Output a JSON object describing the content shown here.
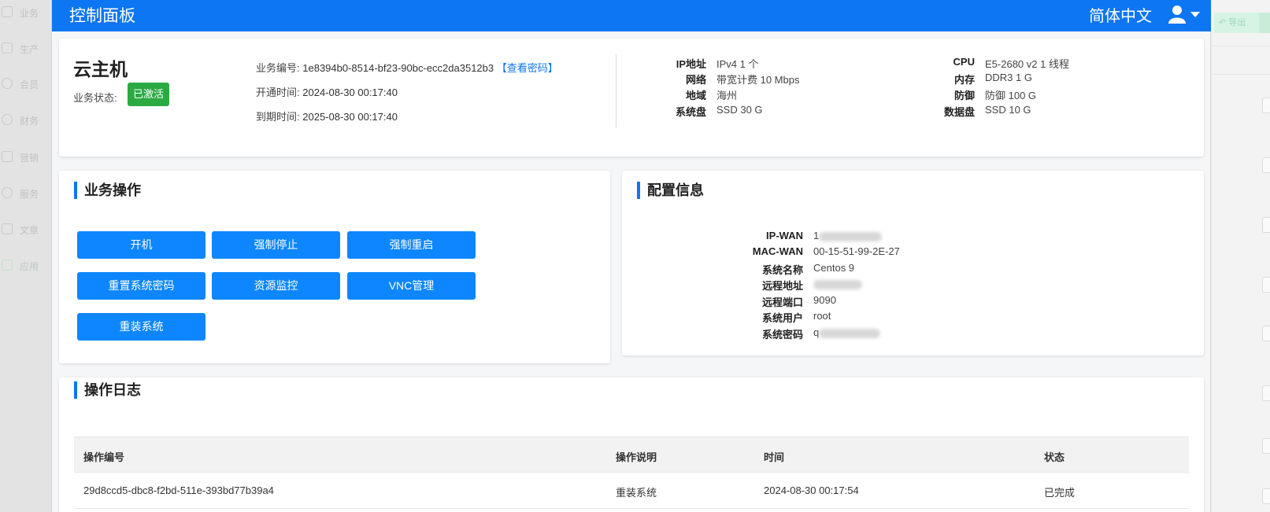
{
  "sidebar": {
    "items": [
      {
        "label": "业务",
        "icon": "document-icon"
      },
      {
        "label": "生产",
        "icon": "store-icon"
      },
      {
        "label": "会员",
        "icon": "user-icon"
      },
      {
        "label": "财务",
        "icon": "yen-icon"
      },
      {
        "label": "营销",
        "icon": "chart-icon"
      },
      {
        "label": "服务",
        "icon": "headset-icon"
      },
      {
        "label": "文章",
        "icon": "article-icon"
      },
      {
        "label": "应用",
        "icon": "cube-icon"
      }
    ]
  },
  "header": {
    "title": "控制面板",
    "language": "简体中文",
    "user_icon": "user-icon"
  },
  "summary": {
    "product_name": "云主机",
    "status_label": "业务状态:",
    "status_value": "已激活",
    "business_id_label": "业务编号:",
    "business_id": "1e8394b0-8514-bf23-90bc-ecc2da3512b3",
    "view_password": "【查看密码】",
    "open_time_label": "开通时间:",
    "open_time": "2024-08-30 00:17:40",
    "expire_time_label": "到期时间:",
    "expire_time": "2025-08-30 00:17:40",
    "specs_left": [
      {
        "key": "IP地址",
        "value": "IPv4 1 个"
      },
      {
        "key": "网络",
        "value": "带宽计费 10 Mbps"
      },
      {
        "key": "地域",
        "value": "海州"
      },
      {
        "key": "系统盘",
        "value": "SSD 30 G"
      }
    ],
    "specs_right": [
      {
        "key": "CPU",
        "value": "E5-2680 v2 1 线程"
      },
      {
        "key": "内存",
        "value": "DDR3 1 G"
      },
      {
        "key": "防御",
        "value": "防御 100 G"
      },
      {
        "key": "数据盘",
        "value": "SSD 10 G"
      }
    ]
  },
  "operations": {
    "title": "业务操作",
    "buttons": [
      "开机",
      "强制停止",
      "强制重启",
      "重置系统密码",
      "资源监控",
      "VNC管理",
      "重装系统"
    ]
  },
  "config": {
    "title": "配置信息",
    "rows": [
      {
        "key": "IP-WAN",
        "value": "1"
      },
      {
        "key": "MAC-WAN",
        "value": "00-15-51-99-2E-27"
      },
      {
        "key": "系统名称",
        "value": "Centos 9"
      },
      {
        "key": "远程地址",
        "value": ""
      },
      {
        "key": "远程端口",
        "value": "9090"
      },
      {
        "key": "系统用户",
        "value": "root"
      },
      {
        "key": "系统密码",
        "value": "q"
      }
    ]
  },
  "log": {
    "title": "操作日志",
    "columns": [
      "操作编号",
      "操作说明",
      "时间",
      "状态"
    ],
    "rows": [
      [
        "29d8ccd5-dbc8-f2bd-511e-393bd77b39a4",
        "重装系统",
        "2024-08-30 00:17:54",
        "已完成"
      ]
    ]
  },
  "right_panel": {
    "export_label": "导出"
  }
}
